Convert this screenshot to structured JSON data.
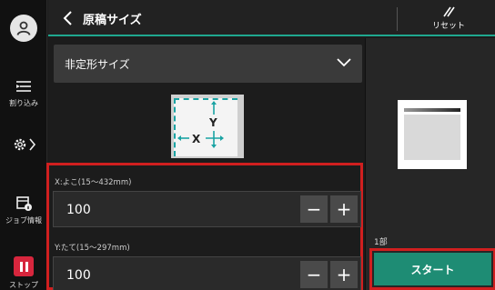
{
  "header": {
    "title": "原稿サイズ",
    "reset_label": "リセット"
  },
  "sidebar": {
    "interrupt_label": "割り込み",
    "job_info_label": "ジョブ情報",
    "stop_label": "ストップ"
  },
  "main": {
    "size_dropdown": {
      "selected": "非定形サイズ"
    },
    "illustration": {
      "x_label": "X",
      "y_label": "Y"
    },
    "x_field": {
      "label": "X:よこ(15〜432mm)",
      "value": "100"
    },
    "y_field": {
      "label": "Y:たて(15〜297mm)",
      "value": "100"
    },
    "minus_glyph": "−",
    "plus_glyph": "+"
  },
  "right_panel": {
    "copies_label": "1部",
    "start_label": "スタート"
  },
  "icons": {
    "avatar": "user-icon",
    "back": "chevron-left-icon",
    "reset": "reset-slash-icon",
    "interrupt": "interrupt-icon",
    "settings": "gear-icon",
    "job_info": "job-info-icon",
    "stop": "stop-icon",
    "dropdown": "chevron-down-icon"
  },
  "colors": {
    "accent_teal": "#1fa88f",
    "start_button": "#1e8c74",
    "highlight_red": "#d01f1f",
    "stop_red": "#d7263d"
  }
}
